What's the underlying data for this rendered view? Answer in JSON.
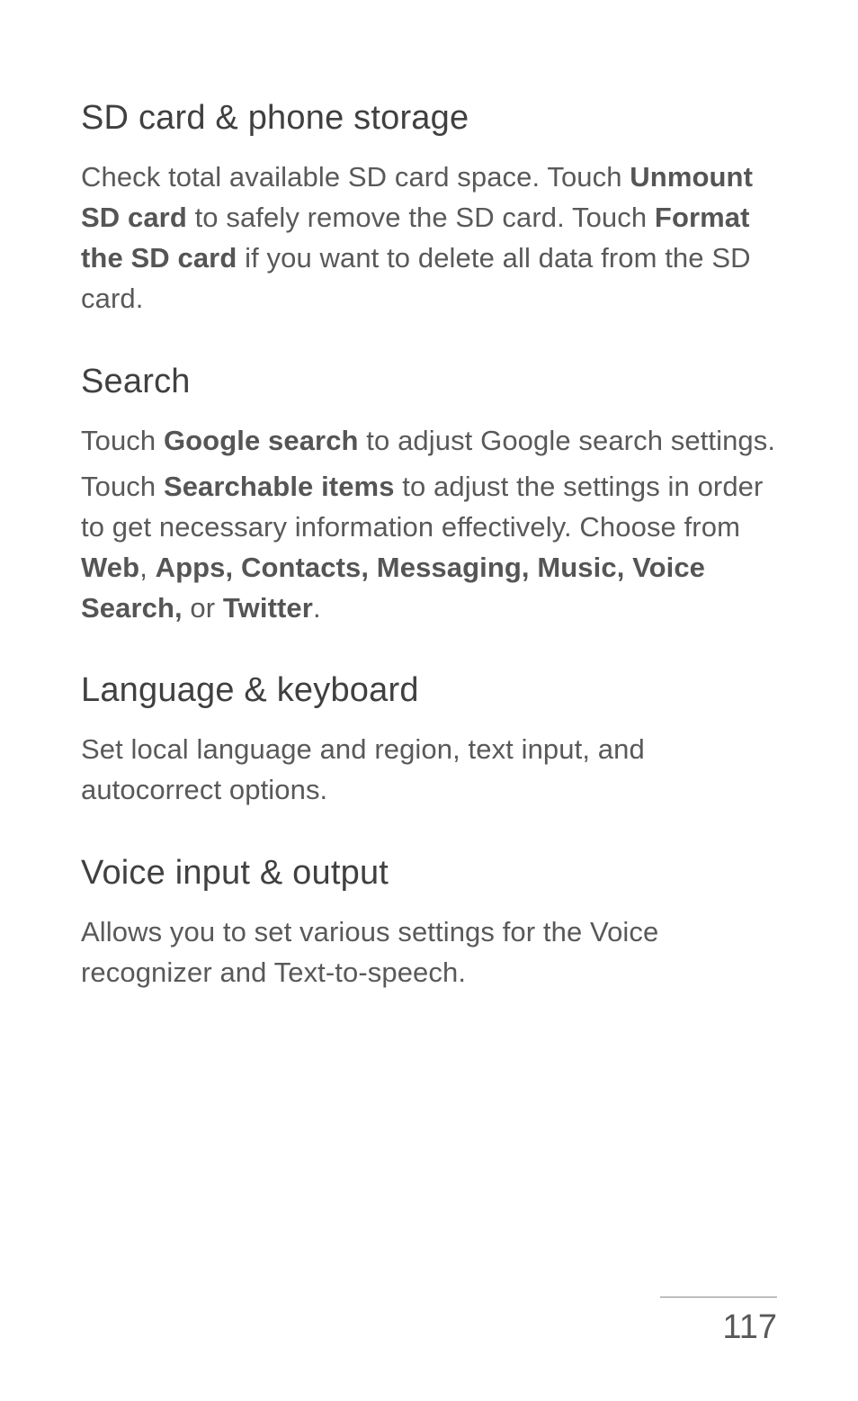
{
  "sections": [
    {
      "heading": "SD card & phone storage",
      "paragraphs": [
        {
          "runs": [
            {
              "text": "Check total available SD card space. Touch ",
              "bold": false
            },
            {
              "text": "Unmount SD card",
              "bold": true
            },
            {
              "text": " to safely remove the SD card. Touch ",
              "bold": false
            },
            {
              "text": "Format the SD card",
              "bold": true
            },
            {
              "text": " if you want to delete all data from the SD card.",
              "bold": false
            }
          ]
        }
      ]
    },
    {
      "heading": "Search",
      "paragraphs": [
        {
          "runs": [
            {
              "text": "Touch ",
              "bold": false
            },
            {
              "text": "Google search",
              "bold": true
            },
            {
              "text": " to adjust Google search settings.",
              "bold": false
            }
          ]
        },
        {
          "runs": [
            {
              "text": "Touch ",
              "bold": false
            },
            {
              "text": "Searchable items",
              "bold": true
            },
            {
              "text": " to adjust the settings in order to get necessary information effectively. Choose from ",
              "bold": false
            },
            {
              "text": "Web",
              "bold": true
            },
            {
              "text": ", ",
              "bold": false
            },
            {
              "text": "Apps, Contacts, Messaging, Music, Voice Search,",
              "bold": true
            },
            {
              "text": " or ",
              "bold": false
            },
            {
              "text": "Twitter",
              "bold": true
            },
            {
              "text": ".",
              "bold": false
            }
          ]
        }
      ]
    },
    {
      "heading": "Language & keyboard",
      "paragraphs": [
        {
          "runs": [
            {
              "text": "Set local language and region, text input, and autocorrect options.",
              "bold": false
            }
          ]
        }
      ]
    },
    {
      "heading": "Voice input & output",
      "paragraphs": [
        {
          "runs": [
            {
              "text": "Allows you to set various settings for the Voice recognizer and Text-to-speech.",
              "bold": false
            }
          ]
        }
      ]
    }
  ],
  "page_number": "117"
}
